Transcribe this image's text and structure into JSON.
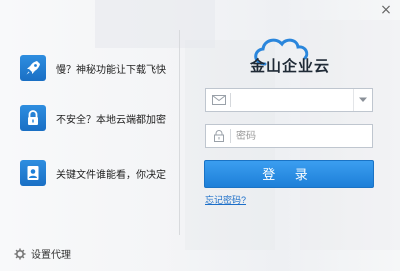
{
  "window": {
    "close_glyph": "×"
  },
  "features": [
    {
      "icon": "rocket-icon",
      "text": "慢？神秘功能让下载飞快"
    },
    {
      "icon": "lock-icon",
      "text": "不安全？本地云端都加密"
    },
    {
      "icon": "user-file-icon",
      "text": "关键文件谁能看，你决定"
    }
  ],
  "brand": {
    "logo_icon": "cloud-logo-icon",
    "name": "金山企业云",
    "color": "#2a86dc"
  },
  "login": {
    "email_value": "",
    "email_placeholder": "",
    "password_value": "",
    "password_placeholder": "密码",
    "submit_label": "登 录",
    "forgot_label": "忘记密码?"
  },
  "footer": {
    "settings_label": "设置代理",
    "settings_icon": "gear-icon"
  },
  "colors": {
    "accent": "#2a86dc",
    "button_top": "#3b9ef0",
    "button_bottom": "#1d7fd8"
  }
}
